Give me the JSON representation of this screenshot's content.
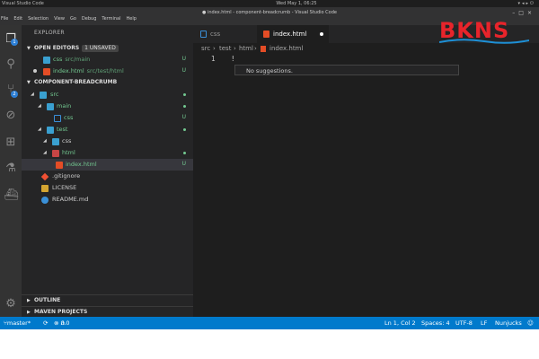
{
  "system": {
    "app": "Visual Studio Code",
    "clock": "Wed May 1, 06:25"
  },
  "window": {
    "title": "● index.html - component-breadcrumb - Visual Studio Code"
  },
  "menu": [
    "File",
    "Edit",
    "Selection",
    "View",
    "Go",
    "Debug",
    "Terminal",
    "Help"
  ],
  "activity": {
    "explorer_badge": "1",
    "scm_badge": "2"
  },
  "sidebar": {
    "title": "EXPLORER",
    "open_editors": {
      "label": "OPEN EDITORS",
      "unsaved": "1 UNSAVED",
      "items": [
        {
          "name": "css",
          "path": "src/main",
          "status": "U"
        },
        {
          "name": "index.html",
          "path": "src/test/html",
          "status": "U"
        }
      ]
    },
    "project": {
      "label": "COMPONENT-BREADCRUMB",
      "tree": [
        {
          "name": "src",
          "status": ""
        },
        {
          "name": "main",
          "status": ""
        },
        {
          "name": "css",
          "status": "U"
        },
        {
          "name": "test",
          "status": ""
        },
        {
          "name": "css",
          "status": ""
        },
        {
          "name": "html",
          "status": ""
        },
        {
          "name": "index.html",
          "status": "U"
        },
        {
          "name": ".gitignore",
          "status": ""
        },
        {
          "name": "LICENSE",
          "status": ""
        },
        {
          "name": "README.md",
          "status": ""
        }
      ]
    },
    "outline_label": "OUTLINE",
    "maven_label": "MAVEN PROJECTS"
  },
  "editor": {
    "tabs": [
      {
        "name": "css",
        "active": false
      },
      {
        "name": "index.html",
        "active": true
      }
    ],
    "breadcrumb": [
      "src",
      "test",
      "html",
      "index.html"
    ],
    "line_number": "1",
    "code": "!",
    "suggestion": "No suggestions."
  },
  "statusbar": {
    "branch": "master*",
    "errors": "0",
    "warnings": "0",
    "position": "Ln 1, Col 2",
    "spaces": "Spaces: 4",
    "encoding": "UTF-8",
    "eol": "LF",
    "language": "Nunjucks"
  },
  "logo": {
    "text": "BKNS"
  },
  "colors": {
    "accent": "#007acc",
    "logo": "#e8242b",
    "untracked": "#73c991"
  }
}
